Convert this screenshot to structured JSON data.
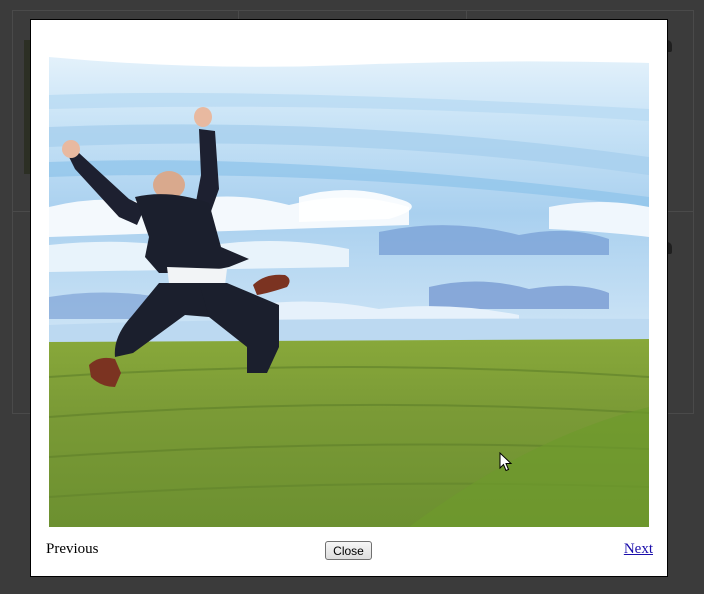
{
  "lightbox": {
    "image_alt": "Businessman in a suit jumping with arms raised over a green field under a cloudy blue sky",
    "prev_label": "Previous",
    "close_label": "Close",
    "next_label": "Next"
  },
  "icons": {
    "cursor": "mouse-pointer-icon"
  },
  "colors": {
    "overlay": "#3a3a3a",
    "modal_bg": "#ffffff",
    "link": "#1a0dab"
  }
}
